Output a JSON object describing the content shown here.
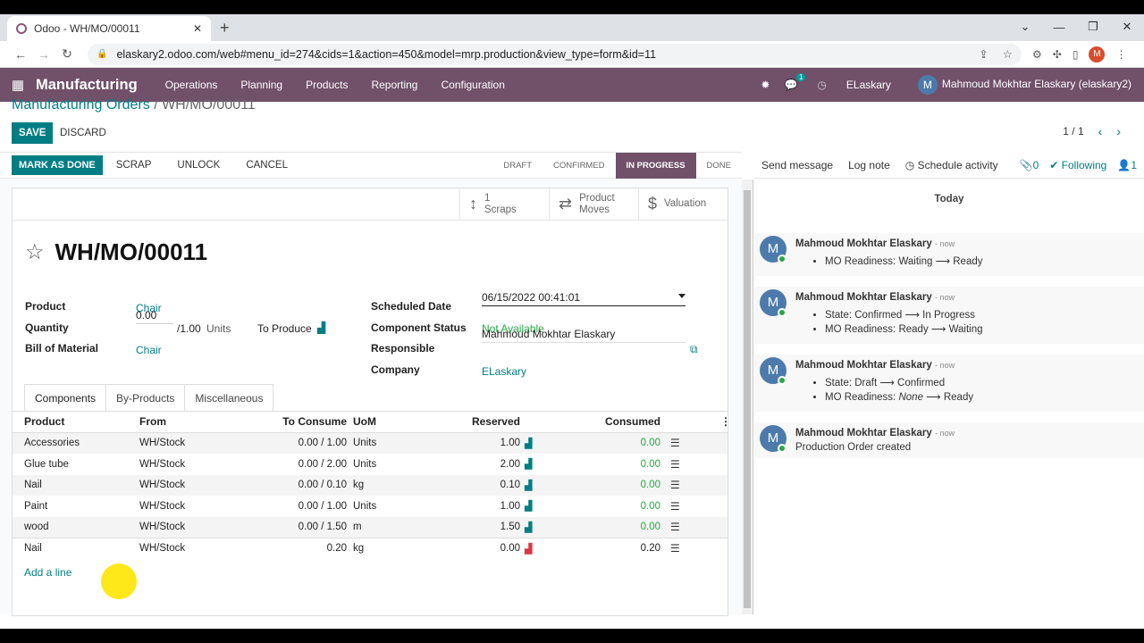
{
  "browser": {
    "tab_title": "Odoo - WH/MO/00011",
    "url": "elaskary2.odoo.com/web#menu_id=274&cids=1&action=450&model=mrp.production&view_type=form&id=11",
    "profile_initial": "M"
  },
  "topnav": {
    "app": "Manufacturing",
    "menus": [
      "Operations",
      "Planning",
      "Products",
      "Reporting",
      "Configuration"
    ],
    "chat_count": "1",
    "company": "ELaskary",
    "user": "Mahmoud Mokhtar Elaskary (elaskary2)",
    "user_initial": "M"
  },
  "breadcrumb": {
    "parent": "Manufacturing Orders",
    "current": "/ WH/MO/00011"
  },
  "controls": {
    "save": "SAVE",
    "discard": "DISCARD",
    "pager": "1 / 1"
  },
  "actions": {
    "mark_done": "MARK AS DONE",
    "scrap": "SCRAP",
    "unlock": "UNLOCK",
    "cancel": "CANCEL"
  },
  "stages": [
    "DRAFT",
    "CONFIRMED",
    "IN PROGRESS",
    "DONE"
  ],
  "smart_buttons": {
    "scraps_count": "1",
    "scraps": "Scraps",
    "moves_1": "Product",
    "moves_2": "Moves",
    "valuation": "Valuation"
  },
  "record": {
    "name": "WH/MO/00011",
    "product_label": "Product",
    "product": "Chair",
    "quantity_label": "Quantity",
    "quantity": "0.00",
    "quantity_total": "/1.00",
    "uom": "Units",
    "to_produce": "To Produce",
    "bom_label": "Bill of Material",
    "bom": "Chair",
    "date_label": "Scheduled Date",
    "date": "06/15/2022 00:41:01",
    "status_label": "Component Status",
    "status": "Not Available",
    "resp_label": "Responsible",
    "resp": "Mahmoud Mokhtar Elaskary",
    "company_label": "Company",
    "company": "ELaskary"
  },
  "tabs": [
    "Components",
    "By-Products",
    "Miscellaneous"
  ],
  "table": {
    "headers": [
      "Product",
      "From",
      "To Consume",
      "UoM",
      "Reserved",
      "Consumed"
    ],
    "rows": [
      [
        "Accessories",
        "WH/Stock",
        "0.00 / 1.00",
        "Units",
        "1.00",
        "0.00"
      ],
      [
        "Glue tube",
        "WH/Stock",
        "0.00 / 2.00",
        "Units",
        "2.00",
        "0.00"
      ],
      [
        "Nail",
        "WH/Stock",
        "0.00 / 0.10",
        "kg",
        "0.10",
        "0.00"
      ],
      [
        "Paint",
        "WH/Stock",
        "0.00 / 1.00",
        "Units",
        "1.00",
        "0.00"
      ],
      [
        "wood",
        "WH/Stock",
        "0.00 / 1.50",
        "m",
        "1.50",
        "0.00"
      ],
      [
        "Nail",
        "WH/Stock",
        "0.20",
        "kg",
        "0.00",
        "0.20"
      ]
    ],
    "add_line": "Add a line"
  },
  "chatter": {
    "send": "Send message",
    "log": "Log note",
    "schedule": "Schedule activity",
    "attachments": "0",
    "following": "Following",
    "followers": "1",
    "today": "Today",
    "author": "Mahmoud Mokhtar Elaskary",
    "time": "- now",
    "m1": [
      "MO Readiness: Waiting ⟶ Ready"
    ],
    "m2": [
      "State: Confirmed ⟶ In Progress",
      "MO Readiness: Ready ⟶ Waiting"
    ],
    "m3": [
      "State: Draft ⟶ Confirmed",
      "MO Readiness:"
    ],
    "m3_none": "None",
    "m3_tail": " ⟶ Ready",
    "m4": "Production Order created"
  }
}
